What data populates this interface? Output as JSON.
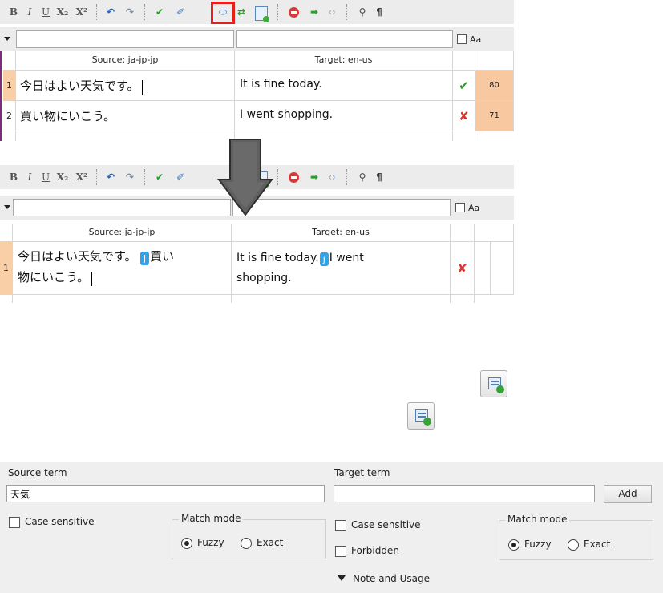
{
  "toolbar": {
    "bold": "B",
    "italic": "I",
    "underline": "U",
    "subscript": "X₂",
    "superscript": "X²",
    "undo_icon": "undo-icon",
    "redo_icon": "redo-icon",
    "confirm_icon": "check-icon",
    "edit_icon": "pencil-icon",
    "join_icon": "join-segments-icon",
    "swap_icon": "swap-icon",
    "add_term_icon": "add-term-icon",
    "stop_icon": "stop-icon",
    "next_icon": "arrow-right-icon",
    "tag_icon": "tag-icon",
    "find_icon": "binoculars-icon",
    "pilcrow": "¶",
    "bold_glyph": "B",
    "italic_glyph": "I",
    "underline_glyph": "U",
    "undo_glyph": "↶",
    "redo_glyph": "↷",
    "check_glyph": "✔",
    "pencil_glyph": "✐",
    "join_glyph": "⬭",
    "swap_glyph": "⇄",
    "arrow_glyph": "➡",
    "tag_glyph": "‹›",
    "find_glyph": "⚲"
  },
  "filter": {
    "source_value": "",
    "target_value": "",
    "match_case_label": "Aa"
  },
  "grid_before": {
    "headers": {
      "source": "Source: ja-jp-jp",
      "target": "Target: en-us"
    },
    "rows": [
      {
        "num": "1",
        "source": "今日はよい天気です。",
        "target": "It is fine today.",
        "status": "✔",
        "score": "80"
      },
      {
        "num": "2",
        "source": "買い物にいこう。",
        "target": "I went shopping.",
        "status": "✘",
        "score": "71"
      }
    ]
  },
  "grid_after": {
    "headers": {
      "source": "Source: ja-jp-jp",
      "target": "Target: en-us"
    },
    "rows": [
      {
        "num": "1",
        "source_a": "今日はよい天気です。",
        "source_b": "買い",
        "source_c": "物にいこう。",
        "target_a": "It is fine today.",
        "target_b": "I went",
        "target_c": "shopping.",
        "tag_glyph": "j",
        "status": "✘"
      }
    ]
  },
  "term_panel": {
    "source_label": "Source term",
    "source_value": "天気",
    "target_label": "Target term",
    "target_value": "",
    "add_button": "Add",
    "source_case_sensitive": "Case sensitive",
    "source_match_mode": "Match mode",
    "source_fuzzy": "Fuzzy",
    "source_exact": "Exact",
    "target_case_sensitive": "Case sensitive",
    "target_forbidden": "Forbidden",
    "target_match_mode": "Match mode",
    "target_fuzzy": "Fuzzy",
    "target_exact": "Exact",
    "note_label": "Note and Usage"
  },
  "colors": {
    "score_bg": "#f8c9a0",
    "confirmed": "#22a022",
    "rejected": "#e0302a",
    "tag": "#32a3e6",
    "highlight": "#e3201b",
    "arrow": "#5a5a5a"
  }
}
